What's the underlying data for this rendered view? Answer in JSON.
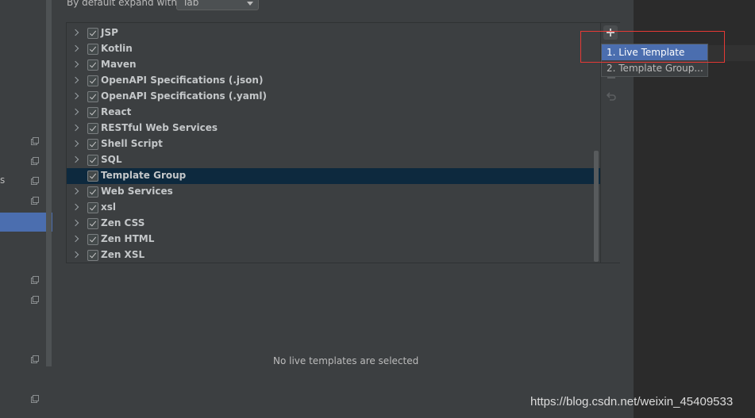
{
  "expand": {
    "label": "By default expand with",
    "value": "Tab"
  },
  "tree": {
    "items": [
      {
        "label": "JSP",
        "checked": true
      },
      {
        "label": "Kotlin",
        "checked": true
      },
      {
        "label": "Maven",
        "checked": true
      },
      {
        "label": "OpenAPI Specifications (.json)",
        "checked": true
      },
      {
        "label": "OpenAPI Specifications (.yaml)",
        "checked": true
      },
      {
        "label": "React",
        "checked": true
      },
      {
        "label": "RESTful Web Services",
        "checked": true
      },
      {
        "label": "Shell Script",
        "checked": true
      },
      {
        "label": "SQL",
        "checked": true
      },
      {
        "label": "Template Group",
        "checked": true
      },
      {
        "label": "Web Services",
        "checked": true
      },
      {
        "label": "xsl",
        "checked": true
      },
      {
        "label": "Zen CSS",
        "checked": true
      },
      {
        "label": "Zen HTML",
        "checked": true
      },
      {
        "label": "Zen XSL",
        "checked": true
      }
    ]
  },
  "toolbar": {
    "add_icon": "plus-icon",
    "remove_icon": "minus-icon",
    "undo_icon": "undo-icon"
  },
  "popup": {
    "items": [
      "1. Live Template",
      "2. Template Group..."
    ]
  },
  "sidebar": {
    "cut_text": "s"
  },
  "empty_message": "No live templates are selected",
  "watermark": "https://blog.csdn.net/weixin_45409533",
  "colors": {
    "selection": "#4b6eaf",
    "selected_row": "#0d293e",
    "highlight_box": "#e53935"
  }
}
